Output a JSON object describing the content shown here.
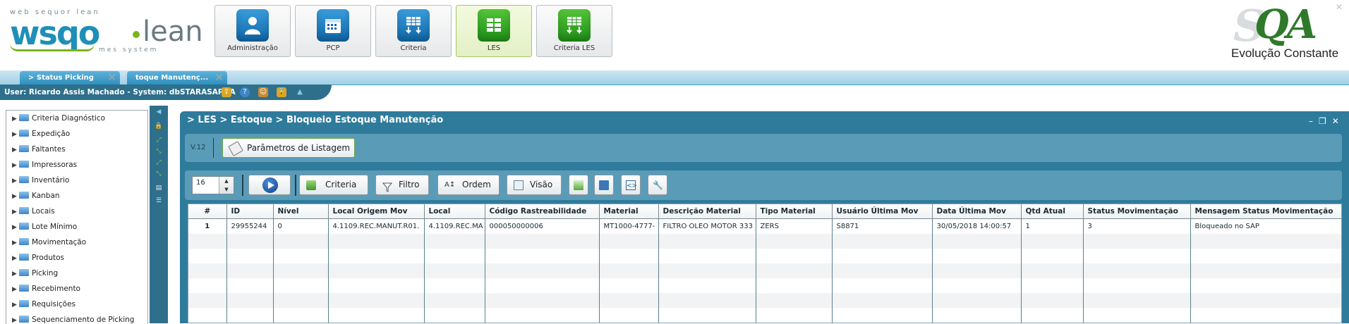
{
  "brand": {
    "tagline_top": "web sequor lean",
    "word_main": "wsqo",
    "word_lean": "lean",
    "tagline_bottom": "mes system",
    "partner_mark": "QA",
    "partner_tagline": "Evolução Constante"
  },
  "modules": [
    {
      "label": "Administração",
      "icon": "user-icon",
      "color": "blue"
    },
    {
      "label": "PCP",
      "icon": "calendar-icon",
      "color": "blue"
    },
    {
      "label": "Criteria",
      "icon": "criteria-icon",
      "color": "blue"
    },
    {
      "label": "LES",
      "icon": "grid-icon",
      "color": "green",
      "active": true
    },
    {
      "label": "Criteria LES",
      "icon": "criteria-les-icon",
      "color": "green"
    }
  ],
  "tabs": [
    {
      "label": "> Status Picking"
    },
    {
      "label": "toque Manutenç..."
    }
  ],
  "userbar": {
    "text": "User: Ricardo Assis Machado - System: dbSTARASAPQA"
  },
  "sidebar": {
    "items": [
      "Criteria Diagnóstico",
      "Expedição",
      "Faltantes",
      "Impressoras",
      "Inventário",
      "Kanban",
      "Locais",
      "Lote Mínimo",
      "Movimentação",
      "Produtos",
      "Picking",
      "Recebimento",
      "Requisições",
      "Sequenciamento de Picking"
    ]
  },
  "panel": {
    "title": "> LES > Estoque > Bloqueio Estoque Manutenção",
    "version": "V.12",
    "params_button": "Parâmetros de Listagem"
  },
  "toolbar": {
    "rows_value": "16",
    "criteria": "Criteria",
    "filter": "Filtro",
    "order": "Ordem",
    "view": "Visão"
  },
  "grid": {
    "columns": [
      "#",
      "ID",
      "Nível",
      "Local Origem Mov",
      "Local",
      "Código Rastreabilidade",
      "Material",
      "Descrição Material",
      "Tipo Material",
      "Usuário Última Mov",
      "Data Última Mov",
      "Qtd Atual",
      "Status Movimentação",
      "Mensagem Status Movimentação"
    ],
    "rows": [
      [
        "1",
        "29955244",
        "0",
        "4.1109.REC.MANUT.R01.",
        "4.1109.REC.MA",
        "000050000006",
        "MT1000-4777-",
        "FILTRO OLEO MOTOR 333",
        "ZERS",
        "S8871",
        "30/05/2018 14:00:57",
        "1",
        "3",
        "Bloqueado no SAP"
      ]
    ]
  }
}
